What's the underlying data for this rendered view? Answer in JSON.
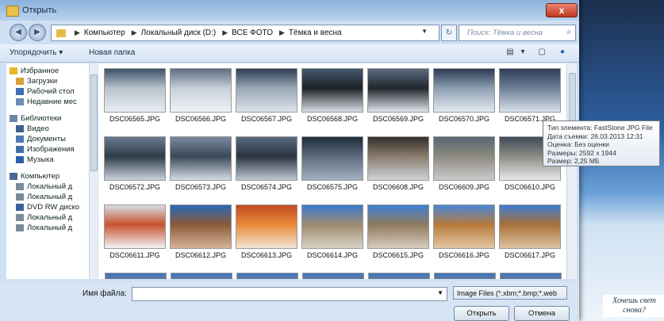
{
  "window": {
    "title": "Открыть",
    "close_label": "x"
  },
  "address": {
    "crumbs": [
      "Компьютер",
      "Локальный диск (D:)",
      "ВСЕ ФОТО",
      "Тёмка и весна"
    ],
    "search_placeholder": "Поиск: Тёмка и весна"
  },
  "toolbar": {
    "organize": "Упорядочить ▾",
    "new_folder": "Новая папка"
  },
  "sidebar": {
    "items": [
      {
        "label": "Избранное",
        "group": true,
        "icon": "star-icon"
      },
      {
        "label": "Загрузки",
        "icon": "downloads-icon"
      },
      {
        "label": "Рабочий стол",
        "icon": "desktop-icon"
      },
      {
        "label": "Недавние мес",
        "icon": "recent-places-icon"
      },
      {
        "label": "Библиотеки",
        "group": true,
        "icon": "libraries-icon"
      },
      {
        "label": "Видео",
        "icon": "video-icon"
      },
      {
        "label": "Документы",
        "icon": "documents-icon"
      },
      {
        "label": "Изображения",
        "icon": "pictures-icon"
      },
      {
        "label": "Музыка",
        "icon": "music-icon"
      },
      {
        "label": "Компьютер",
        "group": true,
        "icon": "computer-icon"
      },
      {
        "label": "Локальный д",
        "icon": "drive-icon"
      },
      {
        "label": "Локальный д",
        "icon": "drive-icon"
      },
      {
        "label": "DVD RW диско",
        "icon": "dvd-icon"
      },
      {
        "label": "Локальный д",
        "icon": "drive-icon"
      },
      {
        "label": "Локальный д",
        "icon": "drive-icon"
      }
    ]
  },
  "files": [
    {
      "name": "DSC06565.JPG",
      "colors": [
        "#3c4f6a",
        "#b9c3cd",
        "#e8edf2"
      ]
    },
    {
      "name": "DSC06566.JPG",
      "colors": [
        "#5f6e80",
        "#c7d0d9",
        "#eef2f6"
      ]
    },
    {
      "name": "DSC06567.JPG",
      "colors": [
        "#2d3d55",
        "#9aa8b6",
        "#dde3ea"
      ]
    },
    {
      "name": "DSC06568.JPG",
      "colors": [
        "#44566e",
        "#1d2226",
        "#d8dee5"
      ]
    },
    {
      "name": "DSC06569.JPG",
      "colors": [
        "#5a6b80",
        "#20262b",
        "#dfe5ec"
      ]
    },
    {
      "name": "DSC06570.JPG",
      "colors": [
        "#2b3b52",
        "#8d9fb2",
        "#e4eaf0"
      ]
    },
    {
      "name": "DSC06571.JPG",
      "colors": [
        "#2f3e56",
        "#6d7f96",
        "#d9e1ea"
      ]
    },
    {
      "name": "DSC06572.JPG",
      "colors": [
        "#6a7b90",
        "#2e3b48",
        "#c8d2dd"
      ]
    },
    {
      "name": "DSC06573.JPG",
      "colors": [
        "#7a8aa0",
        "#3b4858",
        "#d3dbe4"
      ]
    },
    {
      "name": "DSC06574.JPG",
      "colors": [
        "#596a80",
        "#2b3440",
        "#bcc7d3"
      ]
    },
    {
      "name": "DSC06575.JPG",
      "colors": [
        "#1e2a38",
        "#5d6d7e",
        "#a3b1c0"
      ]
    },
    {
      "name": "DSC06608.JPG",
      "colors": [
        "#332e2a",
        "#8a7c6d",
        "#cfd3d8"
      ]
    },
    {
      "name": "DSC06609.JPG",
      "colors": [
        "#566774",
        "#8d8a80",
        "#c9cbcc"
      ]
    },
    {
      "name": "DSC06610.JPG",
      "colors": [
        "#3e4a57",
        "#8e8b84",
        "#e6e9ec"
      ]
    },
    {
      "name": "DSC06611.JPG",
      "colors": [
        "#d9dde3",
        "#c7532e",
        "#f1f3f6"
      ]
    },
    {
      "name": "DSC06612.JPG",
      "colors": [
        "#2b67b8",
        "#8a5a3a",
        "#d5b497"
      ]
    },
    {
      "name": "DSC06613.JPG",
      "colors": [
        "#c24a1f",
        "#e98a3a",
        "#f2e5d5"
      ]
    },
    {
      "name": "DSC06614.JPG",
      "colors": [
        "#3a7bd0",
        "#9d8a70",
        "#d9d2c4"
      ]
    },
    {
      "name": "DSC06615.JPG",
      "colors": [
        "#3f7fd2",
        "#8f7a5d",
        "#d6cdbf"
      ]
    },
    {
      "name": "DSC06616.JPG",
      "colors": [
        "#4a88d8",
        "#b77a3c",
        "#e2c7a3"
      ]
    },
    {
      "name": "DSC06617.JPG",
      "colors": [
        "#3d7cd0",
        "#a8713a",
        "#ddc2a0"
      ]
    }
  ],
  "tooltip": {
    "type": "Тип элемента: FastStone JPG File",
    "date": "Дата съемки: 26.03.2013 12:31",
    "rating": "Оценка: Без оценки",
    "size": "Размеры: 2592 x 1944",
    "filesize": "Размер: 2,25 МБ"
  },
  "bottom": {
    "filename_label": "Имя файла:",
    "filename_value": "",
    "filetype": "Image Files (*.xbm;*.bmp;*.web",
    "open": "Открыть",
    "cancel": "Отмена"
  },
  "background": {
    "promo": "Хочешь свет снова?"
  }
}
